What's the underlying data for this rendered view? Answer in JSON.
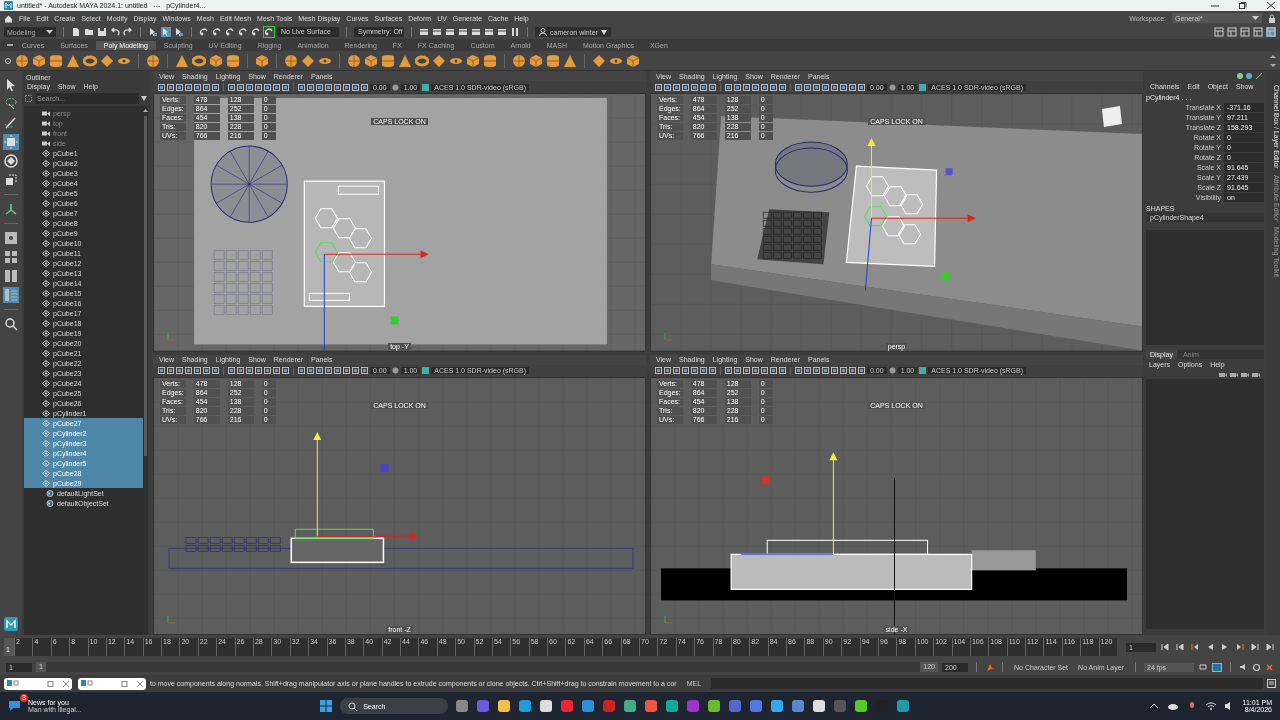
{
  "window": {
    "title": "untitled* - Autodesk MAYA 2024.1: untitled   ---   pCylinder4..."
  },
  "menu_bar": {
    "items": [
      "File",
      "Edit",
      "Create",
      "Select",
      "Modify",
      "Display",
      "Windows",
      "Mesh",
      "Edit Mesh",
      "Mesh Tools",
      "Mesh Display",
      "Curves",
      "Surfaces",
      "Deform",
      "UV",
      "Generate",
      "Cache",
      "Help"
    ],
    "workspace_label": "Workspace:",
    "workspace": "General*"
  },
  "status_line": {
    "mode": "Modeling",
    "live_surface": "No Live Surface",
    "symmetry": "Symmetry: Off",
    "user": "cameron winter"
  },
  "shelf_tabs": [
    {
      "label": "Curves",
      "selected": false
    },
    {
      "label": "Surfaces",
      "selected": false
    },
    {
      "label": "Poly Modeling",
      "selected": true
    },
    {
      "label": "Sculpting",
      "selected": false
    },
    {
      "label": "UV Editing",
      "selected": false
    },
    {
      "label": "Rigging",
      "selected": false
    },
    {
      "label": "Animation",
      "selected": false
    },
    {
      "label": "Rendering",
      "selected": false
    },
    {
      "label": "FX",
      "selected": false
    },
    {
      "label": "FX Caching",
      "selected": false
    },
    {
      "label": "Custom",
      "selected": false
    },
    {
      "label": "Arnold",
      "selected": false
    },
    {
      "label": "MASH",
      "selected": false
    },
    {
      "label": "Motion Graphics",
      "selected": false
    },
    {
      "label": "XGen",
      "selected": false
    }
  ],
  "toolbox": [
    {
      "kind": "select",
      "selected": false
    },
    {
      "kind": "lasso",
      "selected": false
    },
    {
      "kind": "paint",
      "selected": false
    },
    {
      "kind": "move",
      "selected": true
    },
    {
      "kind": "rotate",
      "selected": false
    },
    {
      "kind": "scale",
      "selected": false
    },
    {
      "kind": "manip",
      "selected": false
    },
    {
      "kind": "single",
      "selected": false
    },
    {
      "kind": "four",
      "selected": false
    },
    {
      "kind": "two",
      "selected": false
    },
    {
      "kind": "outliner",
      "selected": true
    },
    {
      "kind": "search",
      "selected": false
    }
  ],
  "outliner": {
    "title": "Outliner",
    "menus": [
      "Display",
      "Show",
      "Help"
    ],
    "search": {
      "placeholder": "Search..."
    },
    "items": [
      {
        "label": "persp",
        "kind": "camera",
        "dimmed": true,
        "selected": false
      },
      {
        "label": "top",
        "kind": "camera",
        "dimmed": true,
        "selected": false
      },
      {
        "label": "front",
        "kind": "camera",
        "dimmed": true,
        "selected": false
      },
      {
        "label": "side",
        "kind": "camera",
        "dimmed": true,
        "selected": false
      },
      {
        "label": "pCube1",
        "kind": "mesh",
        "dimmed": false,
        "selected": false
      },
      {
        "label": "pCube2",
        "kind": "mesh",
        "dimmed": false,
        "selected": false
      },
      {
        "label": "pCube3",
        "kind": "mesh",
        "dimmed": false,
        "selected": false
      },
      {
        "label": "pCube4",
        "kind": "mesh",
        "dimmed": false,
        "selected": false
      },
      {
        "label": "pCube5",
        "kind": "mesh",
        "dimmed": false,
        "selected": false
      },
      {
        "label": "pCube6",
        "kind": "mesh",
        "dimmed": false,
        "selected": false
      },
      {
        "label": "pCube7",
        "kind": "mesh",
        "dimmed": false,
        "selected": false
      },
      {
        "label": "pCube8",
        "kind": "mesh",
        "dimmed": false,
        "selected": false
      },
      {
        "label": "pCube9",
        "kind": "mesh",
        "dimmed": false,
        "selected": false
      },
      {
        "label": "pCube10",
        "kind": "mesh",
        "dimmed": false,
        "selected": false
      },
      {
        "label": "pCube11",
        "kind": "mesh",
        "dimmed": false,
        "selected": false
      },
      {
        "label": "pCube12",
        "kind": "mesh",
        "dimmed": false,
        "selected": false
      },
      {
        "label": "pCube13",
        "kind": "mesh",
        "dimmed": false,
        "selected": false
      },
      {
        "label": "pCube14",
        "kind": "mesh",
        "dimmed": false,
        "selected": false
      },
      {
        "label": "pCube15",
        "kind": "mesh",
        "dimmed": false,
        "selected": false
      },
      {
        "label": "pCube16",
        "kind": "mesh",
        "dimmed": false,
        "selected": false
      },
      {
        "label": "pCube17",
        "kind": "mesh",
        "dimmed": false,
        "selected": false
      },
      {
        "label": "pCube18",
        "kind": "mesh",
        "dimmed": false,
        "selected": false
      },
      {
        "label": "pCube19",
        "kind": "mesh",
        "dimmed": false,
        "selected": false
      },
      {
        "label": "pCube20",
        "kind": "mesh",
        "dimmed": false,
        "selected": false
      },
      {
        "label": "pCube21",
        "kind": "mesh",
        "dimmed": false,
        "selected": false
      },
      {
        "label": "pCube22",
        "kind": "mesh",
        "dimmed": false,
        "selected": false
      },
      {
        "label": "pCube23",
        "kind": "mesh",
        "dimmed": false,
        "selected": false
      },
      {
        "label": "pCube24",
        "kind": "mesh",
        "dimmed": false,
        "selected": false
      },
      {
        "label": "pCube25",
        "kind": "mesh",
        "dimmed": false,
        "selected": false
      },
      {
        "label": "pCube26",
        "kind": "mesh",
        "dimmed": false,
        "selected": false
      },
      {
        "label": "pCylinder1",
        "kind": "mesh",
        "dimmed": false,
        "selected": false
      },
      {
        "label": "pCube27",
        "kind": "mesh",
        "dimmed": false,
        "selected": true
      },
      {
        "label": "pCylinder2",
        "kind": "mesh",
        "dimmed": false,
        "selected": true
      },
      {
        "label": "pCylinder3",
        "kind": "mesh",
        "dimmed": false,
        "selected": true
      },
      {
        "label": "pCylinder4",
        "kind": "mesh",
        "dimmed": false,
        "selected": true
      },
      {
        "label": "pCylinder5",
        "kind": "mesh",
        "dimmed": false,
        "selected": true
      },
      {
        "label": "pCube28",
        "kind": "mesh",
        "dimmed": false,
        "selected": true
      },
      {
        "label": "pCube29",
        "kind": "mesh",
        "dimmed": false,
        "selected": true
      },
      {
        "label": "defaultLightSet",
        "kind": "set",
        "dimmed": false,
        "selected": false
      },
      {
        "label": "defaultObjectSet",
        "kind": "set",
        "dimmed": false,
        "selected": false
      }
    ]
  },
  "viewports": [
    {
      "kind": "top",
      "camera": "top -Y",
      "menus": [
        "View",
        "Shading",
        "Lighting",
        "Show",
        "Renderer",
        "Panels"
      ],
      "exposure": "0.00",
      "gamma": "1.00",
      "color_space": "ACES 1.0 SDR-video (sRGB)",
      "caps": "CAPS LOCK ON",
      "hud": [
        [
          "Verts:",
          "478",
          "128",
          "0"
        ],
        [
          "Edges:",
          "864",
          "252",
          "0"
        ],
        [
          "Faces:",
          "454",
          "138",
          "0"
        ],
        [
          "Tris:",
          "820",
          "228",
          "0"
        ],
        [
          "UVs:",
          "766",
          "216",
          "0"
        ]
      ]
    },
    {
      "kind": "persp",
      "camera": "persp",
      "menus": [
        "View",
        "Shading",
        "Lighting",
        "Show",
        "Renderer",
        "Panels"
      ],
      "exposure": "0.00",
      "gamma": "1.00",
      "color_space": "ACES 1.0 SDR-video (sRGB)",
      "caps": "CAPS LOCK ON",
      "hud": [
        [
          "Verts:",
          "478",
          "128",
          "0"
        ],
        [
          "Edges:",
          "864",
          "252",
          "0"
        ],
        [
          "Faces:",
          "454",
          "138",
          "0"
        ],
        [
          "Tris:",
          "820",
          "228",
          "0"
        ],
        [
          "UVs:",
          "766",
          "216",
          "0"
        ]
      ]
    },
    {
      "kind": "front",
      "camera": "front -Z",
      "menus": [
        "View",
        "Shading",
        "Lighting",
        "Show",
        "Renderer",
        "Panels"
      ],
      "exposure": "0.00",
      "gamma": "1.00",
      "color_space": "ACES 1.0 SDR-video (sRGB)",
      "caps": "CAPS LOCK ON",
      "hud": [
        [
          "Verts:",
          "478",
          "128",
          "0"
        ],
        [
          "Edges:",
          "864",
          "252",
          "0"
        ],
        [
          "Faces:",
          "454",
          "138",
          "0"
        ],
        [
          "Tris:",
          "820",
          "228",
          "0"
        ],
        [
          "UVs:",
          "766",
          "216",
          "0"
        ]
      ]
    },
    {
      "kind": "side",
      "camera": "side -X",
      "menus": [
        "View",
        "Shading",
        "Lighting",
        "Show",
        "Renderer",
        "Panels"
      ],
      "exposure": "0.00",
      "gamma": "1.00",
      "color_space": "ACES 1.0 SDR-video (sRGB)",
      "caps": "CAPS LOCK ON",
      "hud": [
        [
          "Verts:",
          "478",
          "128",
          "0"
        ],
        [
          "Edges:",
          "864",
          "252",
          "0"
        ],
        [
          "Faces:",
          "454",
          "138",
          "0"
        ],
        [
          "Tris:",
          "820",
          "228",
          "0"
        ],
        [
          "UVs:",
          "766",
          "216",
          "0"
        ]
      ]
    }
  ],
  "channel_box": {
    "menus": [
      "Channels",
      "Edit",
      "Object",
      "Show"
    ],
    "object": "pCylinder4 . . .",
    "attributes": [
      {
        "name": "Translate X",
        "value": "-371.16"
      },
      {
        "name": "Translate Y",
        "value": "97.211"
      },
      {
        "name": "Translate Z",
        "value": "158.293"
      },
      {
        "name": "Rotate X",
        "value": "0"
      },
      {
        "name": "Rotate Y",
        "value": "0"
      },
      {
        "name": "Rotate Z",
        "value": "0"
      },
      {
        "name": "Scale X",
        "value": "91.645"
      },
      {
        "name": "Scale Y",
        "value": "27.439"
      },
      {
        "name": "Scale Z",
        "value": "91.645"
      },
      {
        "name": "Visibility",
        "value": "on"
      }
    ],
    "shapes_label": "SHAPES",
    "shape": "pCylinderShape4",
    "side_tabs": [
      "Channel Box / Layer Editor",
      "Attribute Editor",
      "Modeling Toolkit"
    ],
    "layer_tabs": [
      {
        "label": "Display",
        "selected": true
      },
      {
        "label": "Anim",
        "selected": false
      }
    ],
    "layer_menus": [
      "Layers",
      "Options",
      "Help"
    ]
  },
  "time_slider": {
    "ticks": [
      "2",
      "4",
      "6",
      "8",
      "10",
      "12",
      "14",
      "16",
      "18",
      "20",
      "22",
      "24",
      "26",
      "28",
      "30",
      "32",
      "34",
      "36",
      "38",
      "40",
      "42",
      "44",
      "46",
      "48",
      "50",
      "52",
      "54",
      "56",
      "58",
      "60",
      "62",
      "64",
      "66",
      "68",
      "70",
      "72",
      "74",
      "76",
      "78",
      "80",
      "82",
      "84",
      "86",
      "88",
      "90",
      "92",
      "94",
      "96",
      "98",
      "100",
      "102",
      "104",
      "106",
      "108",
      "110",
      "112",
      "114",
      "116",
      "118",
      "120"
    ],
    "current": "1",
    "current_field": "1"
  },
  "range_slider": {
    "start_field": "1",
    "range_start": "1",
    "range_end": "120",
    "end_field": "200",
    "character_set": "No Character Set",
    "anim_layer": "No Anim Layer",
    "fps": "24 fps"
  },
  "command_line": {
    "help": "to move components along normals. Shift+drag manipulator axis or plane handles to extrude components or clone objects. Ctrl+Shift+drag to constrain movement to a cor",
    "language": "MEL"
  },
  "taskbar": {
    "news_badge": "3",
    "news_title": "News for you",
    "news_text": "Man with illegal...",
    "search": "Search",
    "time": "11:01 PM",
    "date": "8/4/2026"
  }
}
